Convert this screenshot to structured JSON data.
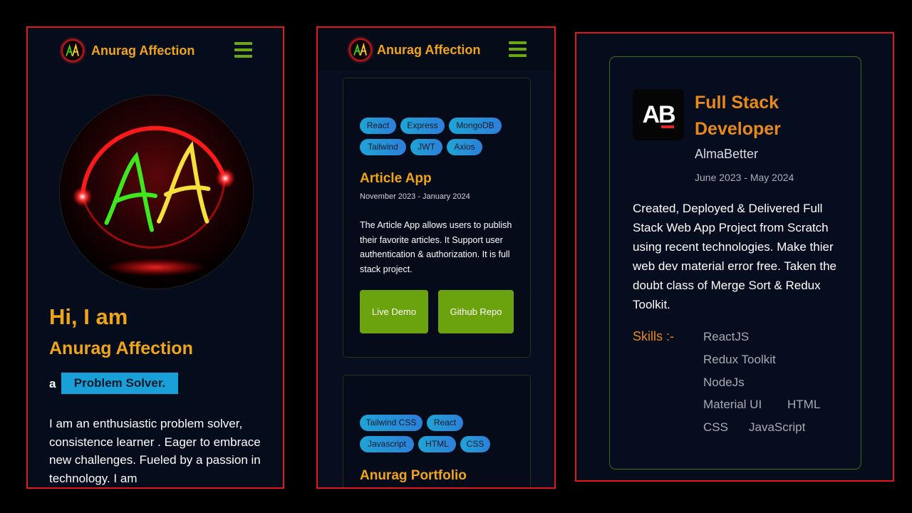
{
  "panel_home": {
    "brand": "Anurag Affection",
    "greeting": "Hi, I am",
    "name": "Anurag Affection",
    "prefix": "a",
    "typed_role": "Problem Solver.",
    "bio": "I am an enthusiastic problem solver, consistence learner . Eager to embrace new challenges. Fueled by a passion in technology. I am"
  },
  "panel_projects": {
    "brand": "Anurag Affection",
    "cards": [
      {
        "tags": [
          "React",
          "Express",
          "MongoDB",
          "Tailwind",
          "JWT",
          "Axios"
        ],
        "title": "Article App",
        "date": "November 2023 - January 2024",
        "description": "The Article App allows users to publish their favorite articles. It Support user authentication & authorization. It is full stack project.",
        "live_demo": "Live Demo",
        "github_repo": "Github Repo"
      },
      {
        "tags": [
          "Tailwind CSS",
          "React",
          "Javascript",
          "HTML",
          "CSS"
        ],
        "title": "Anurag Portfolio"
      }
    ]
  },
  "panel_experience": {
    "logo_text": "AB",
    "role": "Full Stack Developer",
    "company": "AlmaBetter",
    "duration": "June 2023 - May 2024",
    "description": "Created, Deployed & Delivered Full Stack Web App Project from Scratch using recent technologies. Make thier web dev material error free. Taken the doubt class of Merge Sort & Redux Toolkit.",
    "skills_label": "Skills :-",
    "skills": [
      "ReactJS",
      "Redux Toolkit",
      "NodeJs",
      "Material UI",
      "HTML",
      "CSS",
      "JavaScript"
    ]
  },
  "colors": {
    "accent_orange": "#f0a519",
    "button_green": "#6aa30e",
    "tag_blue": "#1fa4d6",
    "frame_red": "#e01818"
  },
  "icons": [
    "aa-logo-icon",
    "hamburger-menu-icon",
    "almabetter-logo"
  ]
}
